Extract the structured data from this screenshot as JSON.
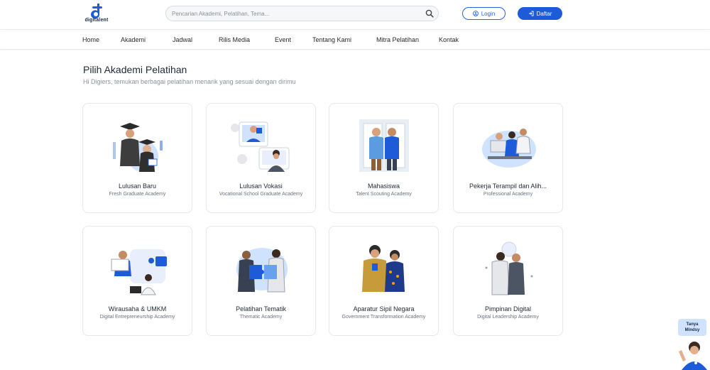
{
  "brand": {
    "name": "digitalent"
  },
  "search": {
    "placeholder": "Pencarian Akademi, Pelatihan, Tema..."
  },
  "auth": {
    "login_label": "Login",
    "register_label": "Daftar"
  },
  "nav": {
    "items": [
      {
        "label": "Home"
      },
      {
        "label": "Akademi"
      },
      {
        "label": "Jadwal"
      },
      {
        "label": "Rilis Media"
      },
      {
        "label": "Event"
      },
      {
        "label": "Tentang Kami"
      },
      {
        "label": "Mitra Pelatihan"
      },
      {
        "label": "Kontak"
      }
    ]
  },
  "main": {
    "title": "Pilih Akademi Pelatihan",
    "subtitle": "Hi Digiers, temukan berbagai pelatihan menarik yang sesuai dengan dirimu",
    "academies": [
      {
        "title": "Lulusan Baru",
        "subtitle": "Fresh Graduate Academy",
        "icon": "graduation-icon"
      },
      {
        "title": "Lulusan Vokasi",
        "subtitle": "Vocational School Graduate Academy",
        "icon": "vocational-icon"
      },
      {
        "title": "Mahasiswa",
        "subtitle": "Talent Scouting Academy",
        "icon": "students-icon"
      },
      {
        "title": "Pekerja Terampil dan Alih...",
        "subtitle": "Professional Academy",
        "icon": "professional-icon"
      },
      {
        "title": "Wirausaha & UMKM",
        "subtitle": "Digital Entrepreneurship Academy",
        "icon": "entrepreneur-icon"
      },
      {
        "title": "Pelatihan Tematik",
        "subtitle": "Thematic Academy",
        "icon": "puzzle-icon"
      },
      {
        "title": "Aparatur Sipil Negara",
        "subtitle": "Government Transformation Academy",
        "icon": "civil-servant-icon"
      },
      {
        "title": "Pimpinan Digital",
        "subtitle": "Digital Leadership Academy",
        "icon": "leadership-icon"
      }
    ]
  },
  "chat_widget": {
    "line1": "Tanya",
    "line2": "Mindsy"
  },
  "colors": {
    "primary": "#1e5bd8",
    "accent_light": "#cfe3ff",
    "text_dark": "#1f2937",
    "text_muted": "#8b93a1"
  }
}
